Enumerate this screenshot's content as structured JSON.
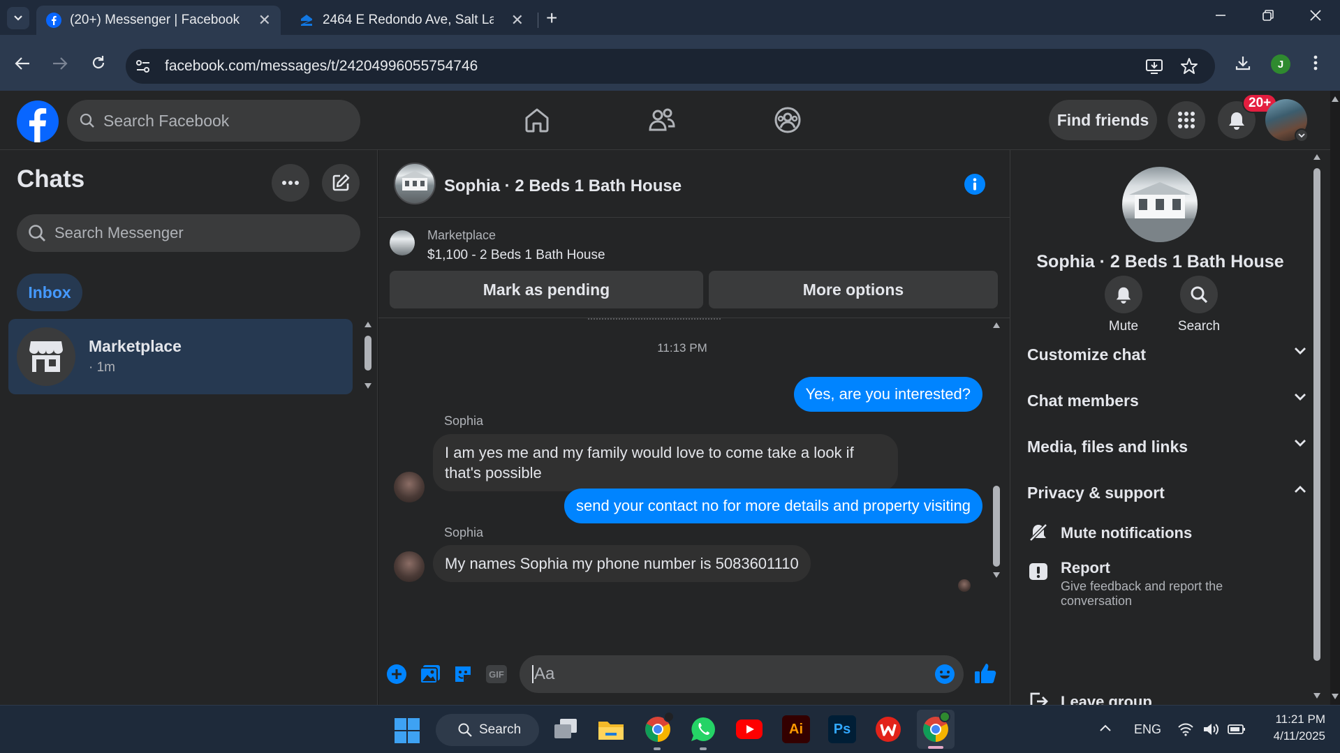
{
  "browser": {
    "tabs": [
      {
        "title": "(20+) Messenger | Facebook",
        "active": true
      },
      {
        "title": "2464 E Redondo Ave, Salt Lake",
        "active": false
      }
    ],
    "url": "facebook.com/messages/t/24204996055754746",
    "profile_letter": "J"
  },
  "fb_header": {
    "search_placeholder": "Search Facebook",
    "find_friends": "Find friends",
    "notification_badge": "20+"
  },
  "left_panel": {
    "title": "Chats",
    "search_placeholder": "Search Messenger",
    "inbox_label": "Inbox",
    "chats": [
      {
        "name": "Marketplace",
        "meta": "· 1m"
      }
    ]
  },
  "conversation": {
    "title": "Sophia · 2 Beds 1 Bath House",
    "listing_source": "Marketplace",
    "listing_title": "$1,100 - 2 Beds 1 Bath House",
    "mark_pending": "Mark as pending",
    "more_options": "More options",
    "timestamp": "11:13 PM",
    "messages": [
      {
        "from": "me",
        "text": "Yes, are you interested?"
      },
      {
        "from": "Sophia",
        "sender_label": "Sophia",
        "text": "I am yes me and my family would love to come take a look if that's possible"
      },
      {
        "from": "me",
        "text": "send your contact no for more details and property visiting"
      },
      {
        "from": "Sophia",
        "sender_label": "Sophia",
        "text": "My names Sophia my phone number is 5083601110"
      }
    ],
    "composer_placeholder": "Aa",
    "gif_label": "GIF"
  },
  "right_panel": {
    "name": "Sophia · 2 Beds 1 Bath House",
    "mute_label": "Mute",
    "search_label": "Search",
    "sections": [
      {
        "label": "Customize chat",
        "expanded": false
      },
      {
        "label": "Chat members",
        "expanded": false
      },
      {
        "label": "Media, files and links",
        "expanded": false
      },
      {
        "label": "Privacy & support",
        "expanded": true
      }
    ],
    "mute_notifications": "Mute notifications",
    "report_title": "Report",
    "report_desc": "Give feedback and report the conversation",
    "leave_group": "Leave group"
  },
  "taskbar": {
    "search_label": "Search",
    "language": "ENG",
    "time": "11:21 PM",
    "date": "4/11/2025",
    "ai_label": "Ai",
    "ps_label": "Ps"
  },
  "colors": {
    "fb_blue": "#0866ff",
    "messenger_blue": "#0084ff",
    "notification_red": "#e41e3f"
  }
}
